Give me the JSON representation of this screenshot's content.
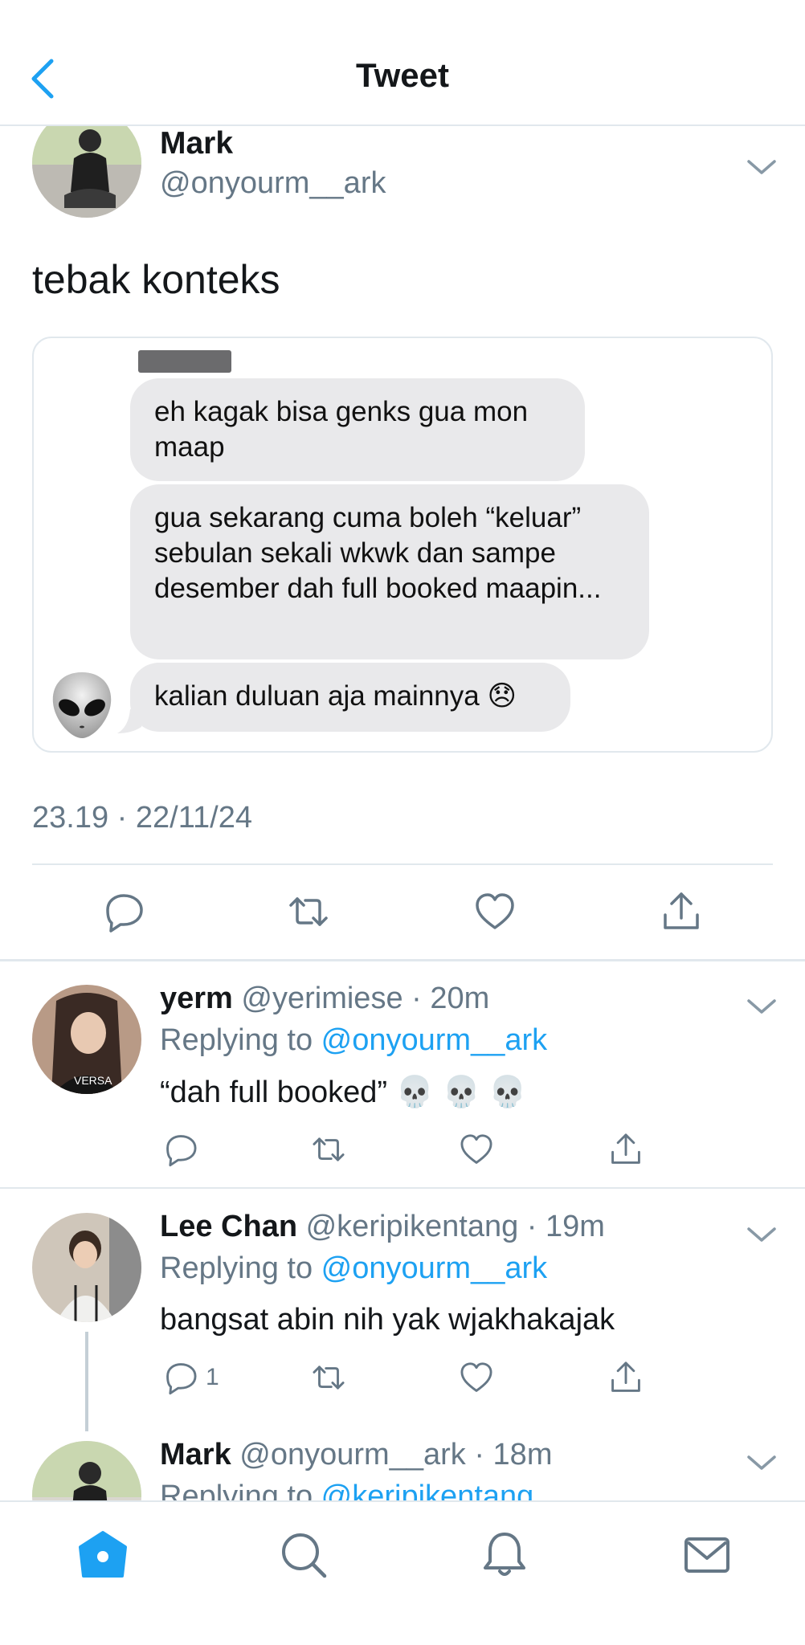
{
  "header": {
    "title": "Tweet",
    "back_icon": "chevron-left-icon"
  },
  "tweet": {
    "author_name": "Mark",
    "author_handle": "@onyourm__ark",
    "text": "tebak konteks",
    "media": {
      "messages": [
        "eh kagak bisa genks gua mon maap",
        "gua sekarang cuma boleh “keluar” sebulan sekali wkwk dan sampe desember dah full booked maapin...",
        "kalian duluan aja mainnya 😞"
      ],
      "sender_avatar": "alien-emoji"
    },
    "timestamp": "23.19 · 22/11/24",
    "actions": [
      "reply-icon",
      "retweet-icon",
      "like-icon",
      "share-icon"
    ]
  },
  "replies": [
    {
      "name": "yerm",
      "handle": "@yerimiese",
      "time": "20m",
      "replying_label": "Replying to ",
      "replying_to": "@onyourm__ark",
      "text": "“dah full booked” 💀 💀 💀",
      "reply_count": ""
    },
    {
      "name": "Lee Chan",
      "handle": "@keripikentang",
      "time": "19m",
      "replying_label": "Replying to ",
      "replying_to": "@onyourm__ark",
      "text": "bangsat abin nih yak wjakhakajak",
      "reply_count": "1"
    },
    {
      "name": "Mark",
      "handle": "@onyourm__ark",
      "time": "18m",
      "replying_label": "Replying to ",
      "replying_to": "@keripikentang",
      "text": "",
      "reply_count": ""
    }
  ],
  "tabbar": {
    "items": [
      "home-icon",
      "search-icon",
      "notifications-icon",
      "messages-icon"
    ],
    "active": "home-icon",
    "active_color": "#1da1f2",
    "inactive_color": "#657786"
  },
  "colors": {
    "accent": "#1da1f2",
    "muted": "#657786",
    "text": "#14171a",
    "border": "#e1e8ed"
  }
}
